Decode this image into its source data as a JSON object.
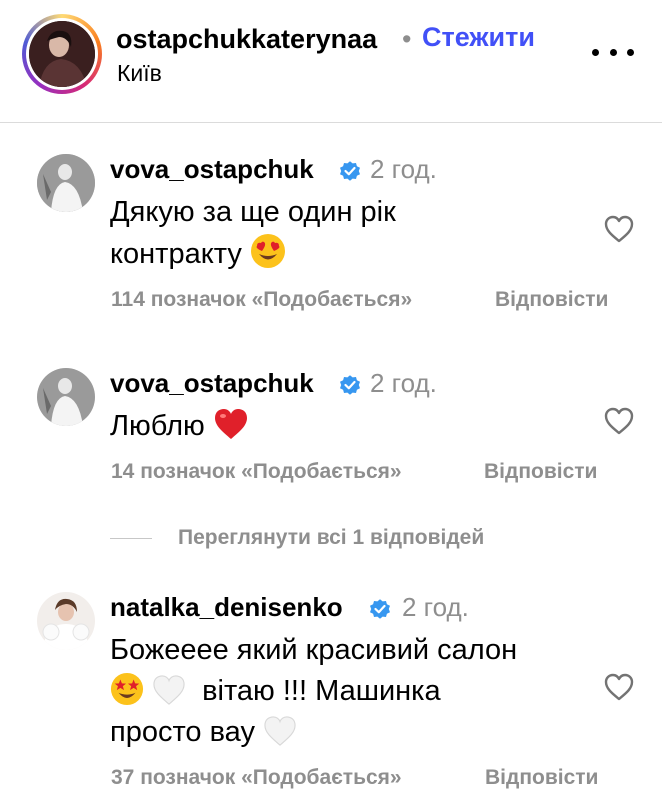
{
  "header": {
    "username": "ostapchukkaterynaa",
    "separator": "•",
    "follow_label": "Стежити",
    "location": "Київ",
    "more_icon": "more-horizontal-icon"
  },
  "comments": [
    {
      "username": "vova_ostapchuk",
      "verified": true,
      "time": "2 год.",
      "text_lines": [
        "Дякую за ще один рік",
        "контракту"
      ],
      "emojis": [
        "smiling-face-with-heart-eyes"
      ],
      "likes": "114 позначок «Подобається»",
      "reply_label": "Відповісти"
    },
    {
      "username": "vova_ostapchuk",
      "verified": true,
      "time": "2 год.",
      "text_lines": [
        "Люблю"
      ],
      "emojis": [
        "red-heart"
      ],
      "likes": "14 позначок «Подобається»",
      "reply_label": "Відповісти"
    },
    {
      "username": "natalka_denisenko",
      "verified": true,
      "time": "2 год.",
      "text_lines": [
        "Божееее який красивий салон",
        "вітаю !!! Машинка",
        "просто вау"
      ],
      "emojis": [
        "star-struck",
        "white-heart",
        "white-heart"
      ],
      "likes": "37 позначок «Подобається»",
      "reply_label": "Відповісти"
    }
  ],
  "view_replies_label": "Переглянути всі 1 відповідей",
  "colors": {
    "accent": "#4150f7",
    "secondary_text": "#8e8e8e",
    "verified_blue": "#3797f0",
    "heart_red": "#e0202a"
  }
}
